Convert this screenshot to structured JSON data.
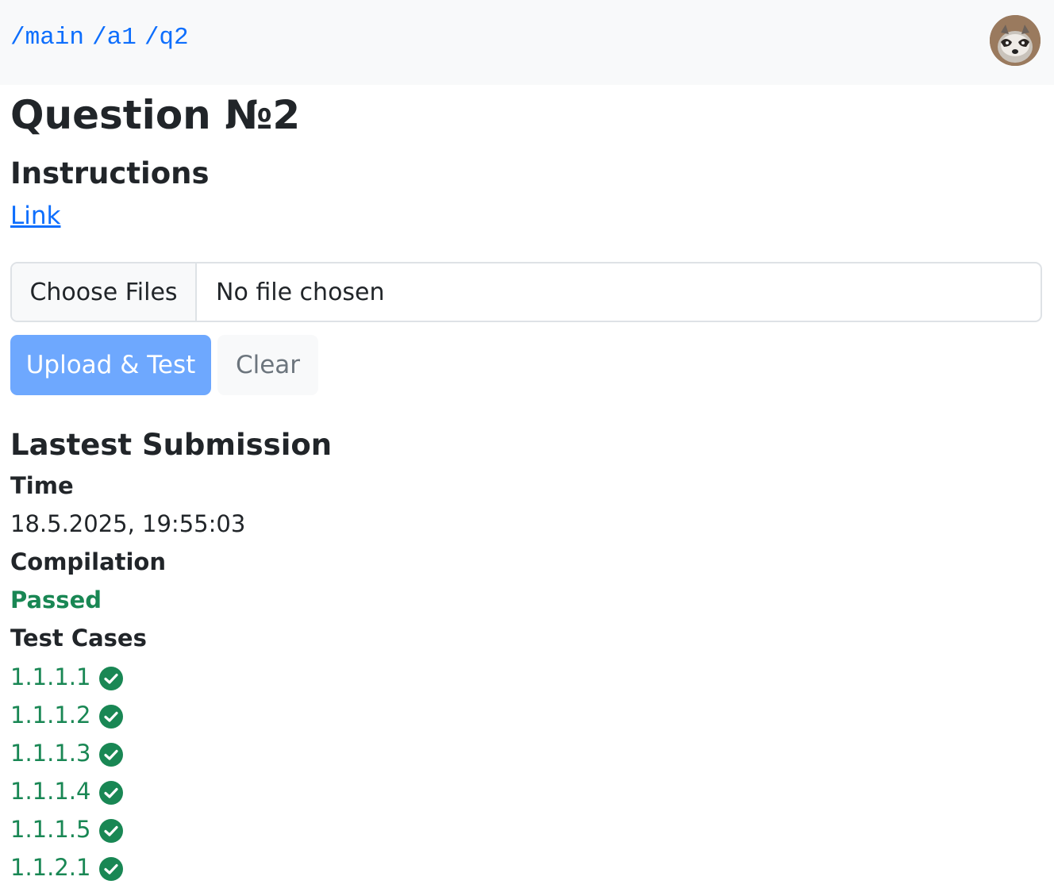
{
  "breadcrumb": [
    "/main",
    "/a1",
    "/q2"
  ],
  "page_title": "Question №2",
  "instructions": {
    "heading": "Instructions",
    "link_label": "Link"
  },
  "file_input": {
    "button_label": "Choose Files",
    "status": "No file chosen"
  },
  "actions": {
    "upload_label": "Upload & Test",
    "clear_label": "Clear"
  },
  "submission": {
    "heading": "Lastest Submission",
    "time_label": "Time",
    "time_value": "18.5.2025, 19:55:03",
    "compilation_label": "Compilation",
    "compilation_value": "Passed",
    "test_cases_label": "Test Cases",
    "test_cases": [
      "1.1.1.1",
      "1.1.1.2",
      "1.1.1.3",
      "1.1.1.4",
      "1.1.1.5",
      "1.1.2.1"
    ]
  },
  "colors": {
    "accent": "#0d6efd",
    "primary_button": "#6ea8fe",
    "success": "#198754"
  },
  "icons": {
    "user": "avatar",
    "test_pass": "check-circle-icon"
  }
}
